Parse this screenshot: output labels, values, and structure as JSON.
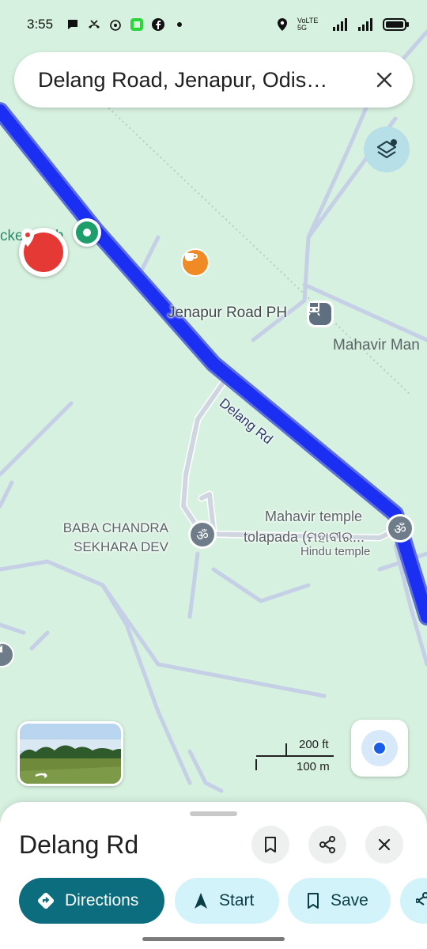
{
  "status_bar": {
    "time": "3:55",
    "network": "VoLTE 5G"
  },
  "search": {
    "query": "Delang Road, Jenapur, Odis…"
  },
  "map": {
    "labels": {
      "place_partial": "cke",
      "place_partial_2": "h",
      "jenapur_road_ph": "Jenapur Road PH",
      "mahavir_man": "Mahavir Man",
      "road_name": "Delang Rd",
      "baba_line1": "BABA CHANDRA",
      "baba_line2": "SEKHARA DEV",
      "mahavir_temple_line1": "Mahavir temple",
      "mahavir_temple_line2": "tolapada (ମହାବୀର...",
      "hindu_temple": "Hindu temple"
    },
    "scale": {
      "imperial": "200 ft",
      "metric": "100 m"
    },
    "colors": {
      "route": "#1a2ff2",
      "map_bg": "#d7f1e0",
      "road": "#c8d3e8"
    }
  },
  "sheet": {
    "title": "Delang Rd",
    "actions": [
      {
        "label": "Directions",
        "icon": "directions-icon"
      },
      {
        "label": "Start",
        "icon": "navigation-arrow-icon"
      },
      {
        "label": "Save",
        "icon": "bookmark-icon"
      }
    ]
  }
}
